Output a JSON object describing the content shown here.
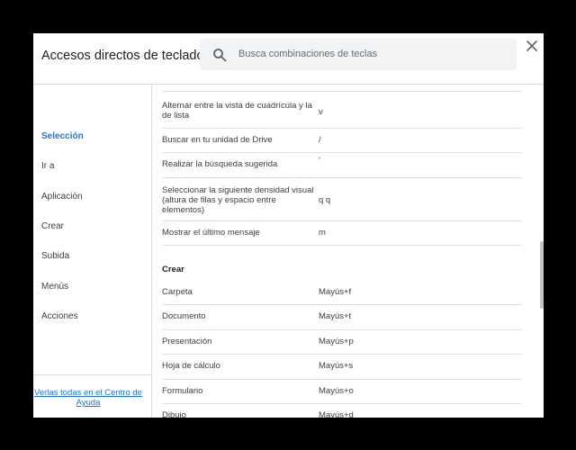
{
  "dialog": {
    "title": "Accesos directos de teclado",
    "search_placeholder": "Busca combinaciones de teclas"
  },
  "sidebar": {
    "items": [
      {
        "label": "Selección"
      },
      {
        "label": "Ir a"
      },
      {
        "label": "Aplicación"
      },
      {
        "label": "Crear"
      },
      {
        "label": "Subida"
      },
      {
        "label": "Menús"
      },
      {
        "label": "Acciones"
      }
    ],
    "help_link": "Verlas todas en el Centro de Ayuda"
  },
  "shortcuts": {
    "rows": [
      {
        "desc": "Alternar entre la vista de cuadrícula y la de lista",
        "keys": "v"
      },
      {
        "desc": "Buscar en tu unidad de Drive",
        "keys": "/"
      },
      {
        "desc": "Realizar la búsqueda sugerida",
        "keys": "'"
      },
      {
        "desc": "Seleccionar la siguiente densidad visual (altura de filas y espacio entre elementos)",
        "keys": "q q"
      },
      {
        "desc": "Mostrar el último mensaje",
        "keys": "m"
      }
    ],
    "section_title": "Crear",
    "create_rows": [
      {
        "desc": "Carpeta",
        "keys": "Mayús+f"
      },
      {
        "desc": "Documento",
        "keys": "Mayús+t"
      },
      {
        "desc": "Presentación",
        "keys": "Mayús+p"
      },
      {
        "desc": "Hoja de cálculo",
        "keys": "Mayús+s"
      },
      {
        "desc": "Formulario",
        "keys": "Mayús+o"
      },
      {
        "desc": "Dibujo",
        "keys": "Mayús+d"
      }
    ]
  },
  "icons": {
    "search": "search-icon",
    "close": "close-icon"
  },
  "colors": {
    "accent": "#1a73e8",
    "divider": "#dadce0"
  }
}
